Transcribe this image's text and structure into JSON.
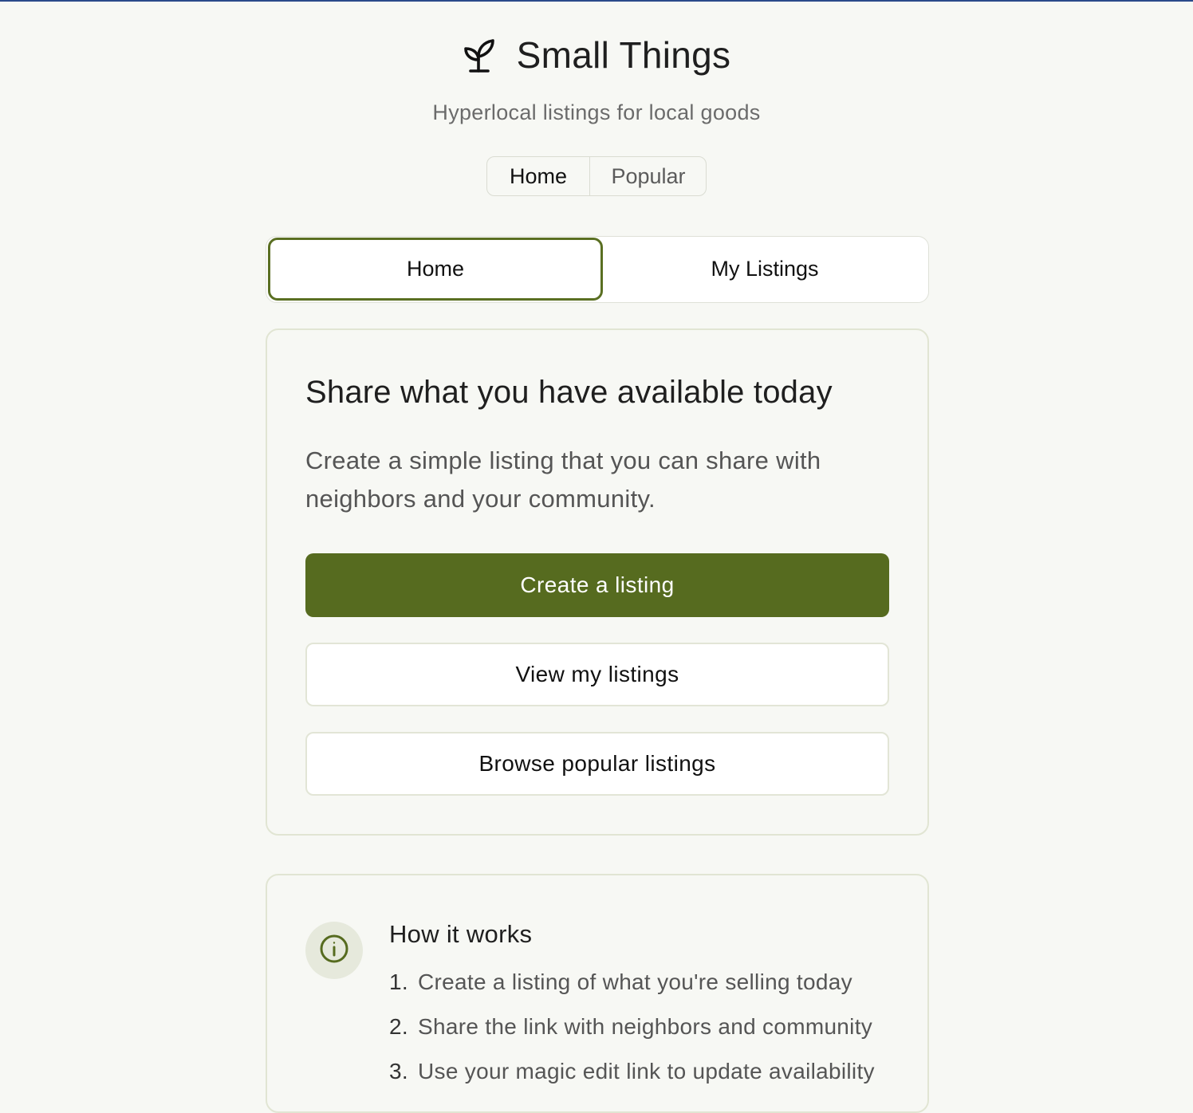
{
  "app": {
    "title": "Small Things",
    "subtitle": "Hyperlocal listings for local goods",
    "logo_icon": "sprout-icon"
  },
  "top_nav": {
    "items": [
      {
        "label": "Home",
        "active": true
      },
      {
        "label": "Popular",
        "active": false
      }
    ]
  },
  "segmented_tabs": {
    "items": [
      {
        "label": "Home",
        "active": true
      },
      {
        "label": "My Listings",
        "active": false
      }
    ]
  },
  "main_card": {
    "heading": "Share what you have available today",
    "description": "Create a simple listing that you can share with neighbors and your community.",
    "primary_button": "Create a listing",
    "secondary_button_1": "View my listings",
    "secondary_button_2": "Browse popular listings"
  },
  "how_it_works": {
    "icon": "info-icon",
    "title": "How it works",
    "steps": [
      {
        "num": "1.",
        "text": "Create a listing of what you're selling today"
      },
      {
        "num": "2.",
        "text": "Share the link with neighbors and community"
      },
      {
        "num": "3.",
        "text": "Use your magic edit link to update availability"
      }
    ]
  },
  "colors": {
    "accent": "#566b1f",
    "background": "#f7f8f4",
    "border": "#e1e5d3"
  }
}
